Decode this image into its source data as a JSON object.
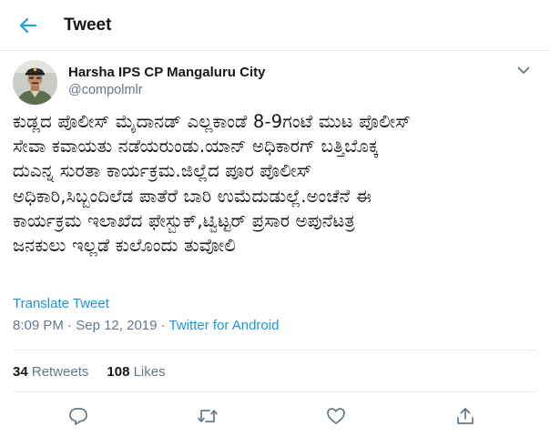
{
  "header": {
    "title": "Tweet",
    "back_icon": "back-arrow-icon",
    "accent_color": "#1da1f2"
  },
  "author": {
    "name": "Harsha IPS CP Mangaluru City",
    "handle": "@compolmlr"
  },
  "tweet": {
    "lines": [
      "ಕುಡ್ಲದ ಪೊಲೀಸ್ ಮೈದಾನಡ್ ಎಲ್ಲಕಾಂಡೆ 8-9ಗಂಟೆ ಮುಟ ಪೊಲೀಸ್",
      "ಸೇವಾ ಕವಾಯತು ನಡೆಯರುಂಡು.ಯಾನ್ ಅಧಿಕಾರಗ್ ಬತ್ತಿಬೊಕ್ಕ",
      "ದುಎನ್ನ ಸುರತಾ ಕಾರ್ಯಕ್ರಮ.ಜಿಲ್ಲೆದ ಪೂರ ಪೊಲೀಸ್",
      "ಅಧಿಕಾರಿ,ಸಿಬ್ಬಂದಿಲೆಡ ಪಾತೆರೆ ಬಾರಿ ಉಮೆದುಡುಲ್ಲೆ.ಅಂಚೆನೆ ಈ",
      "ಕಾರ್ಯಕ್ರಮ ಇಲಾಖೆದ ಫೇಸ್ಬುಕ್,ಟ್ವಿಟ್ಟರ್ ಪ್ರಸಾರ ಅಪುನೆಟತ್ರ",
      "ಜನಕುಲು ಇಲ್ಲಡೆ ಕುಲೊಂದು ತುವೋಲಿ"
    ],
    "translate_label": "Translate Tweet",
    "time": "8:09 PM",
    "separator": " · ",
    "date": "Sep 12, 2019",
    "source": "Twitter for Android"
  },
  "stats": {
    "retweets_count": "34",
    "retweets_label": "Retweets",
    "likes_count": "108",
    "likes_label": "Likes"
  },
  "actions": [
    {
      "icon": "reply-icon"
    },
    {
      "icon": "retweet-icon"
    },
    {
      "icon": "like-icon"
    },
    {
      "icon": "share-icon"
    }
  ]
}
